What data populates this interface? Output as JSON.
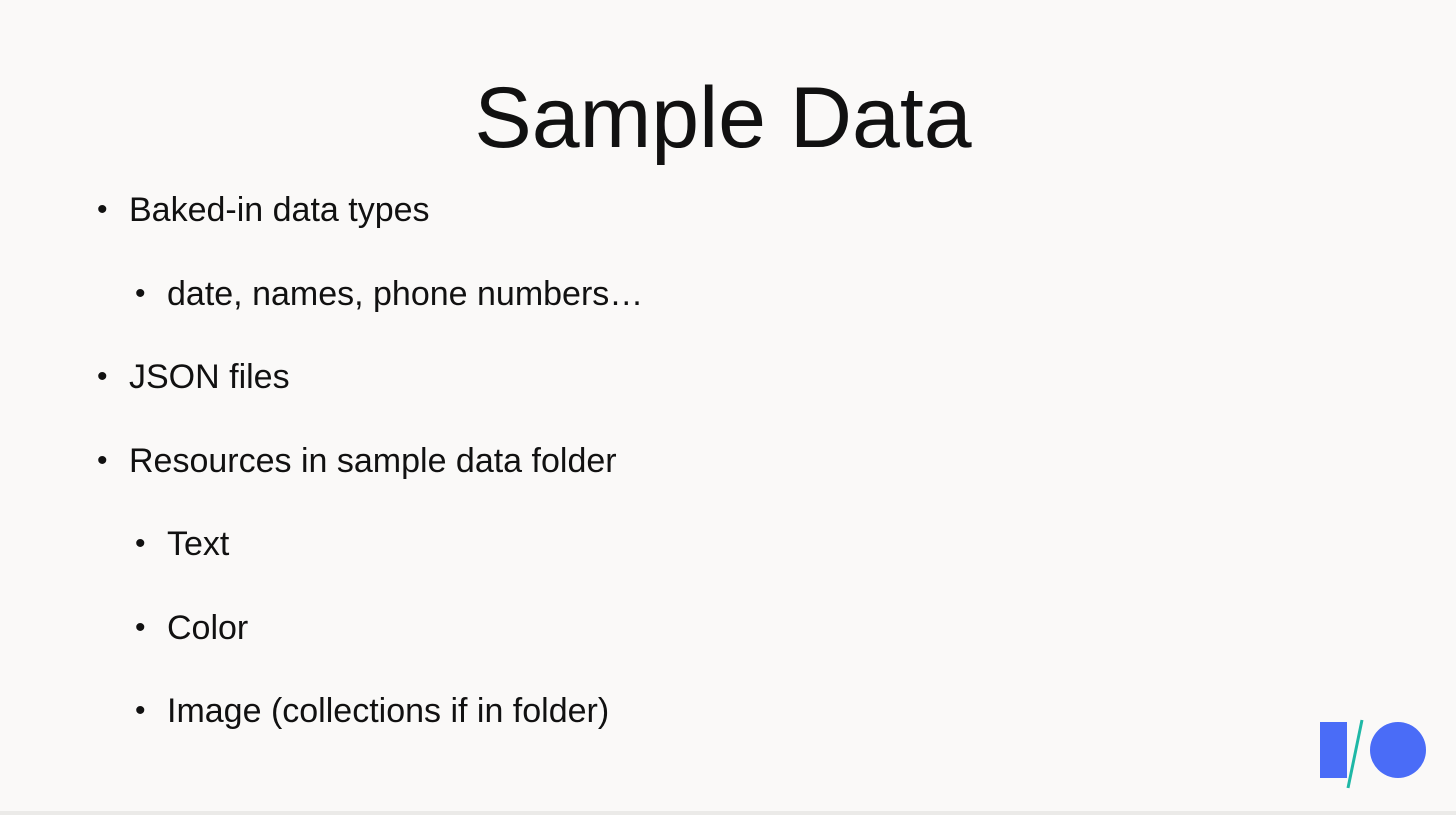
{
  "slide": {
    "title": "Sample Data",
    "bullets": [
      {
        "text": "Baked-in data types",
        "level": 1
      },
      {
        "text": "date, names, phone numbers…",
        "level": 2
      },
      {
        "text": "JSON files",
        "level": 1
      },
      {
        "text": "Resources in sample data folder",
        "level": 1
      },
      {
        "text": "Text",
        "level": 2
      },
      {
        "text": "Color",
        "level": 2
      },
      {
        "text": "Image (collections if in folder)",
        "level": 2
      }
    ],
    "bullet_glyph": "•"
  },
  "logo": {
    "icon": "google-io-logo",
    "colors": {
      "bar": "#4a6cf7",
      "slash": "#1fb8a6",
      "circle": "#4a6cf7"
    }
  }
}
